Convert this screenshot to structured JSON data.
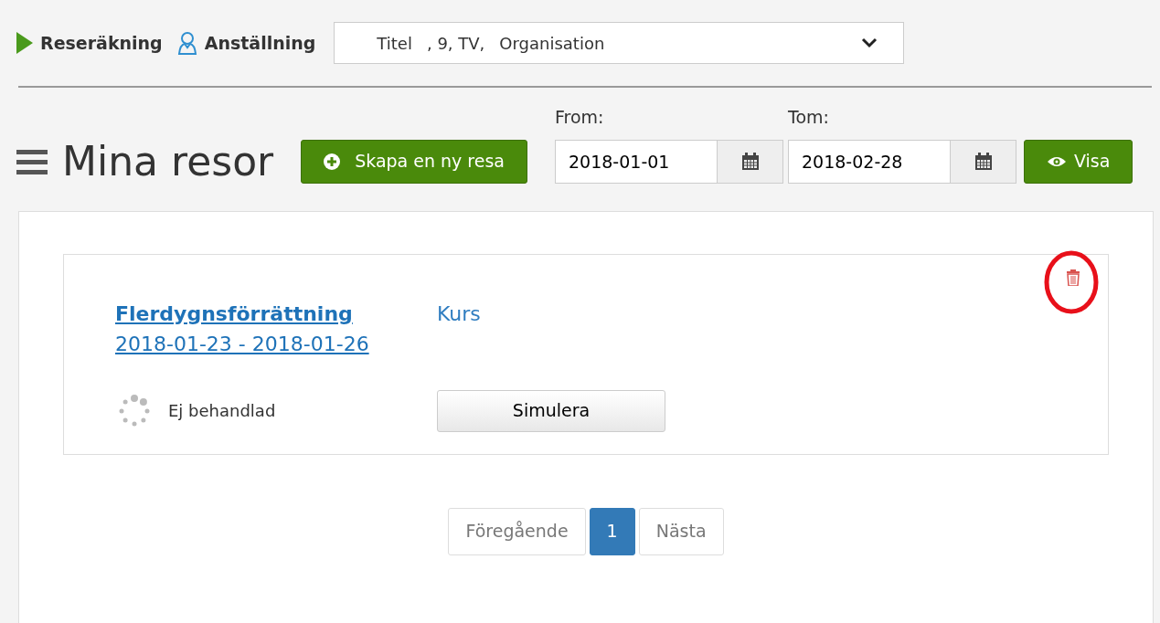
{
  "header": {
    "breadcrumbs": [
      {
        "label": "Reseräkning"
      },
      {
        "label": "Anställning"
      }
    ],
    "employment_select": {
      "parts": [
        "Titel",
        ", 9, TV,",
        "Organisation"
      ]
    }
  },
  "toolbar": {
    "title": "Mina resor",
    "create_button": "Skapa en ny resa",
    "from": {
      "label": "From:",
      "value": "2018-01-01"
    },
    "to": {
      "label": "Tom:",
      "value": "2018-02-28"
    },
    "show_button": "Visa"
  },
  "trips": [
    {
      "title": "Flerdygnsförrättning",
      "dates": "2018-01-23 - 2018-01-26",
      "type": "Kurs",
      "status": "Ej behandlad",
      "action": "Simulera",
      "delete_highlighted": true
    }
  ],
  "pagination": [
    {
      "label": "Föregående",
      "selected": false
    },
    {
      "label": "1",
      "selected": true
    },
    {
      "label": "Nästa",
      "selected": false
    }
  ]
}
